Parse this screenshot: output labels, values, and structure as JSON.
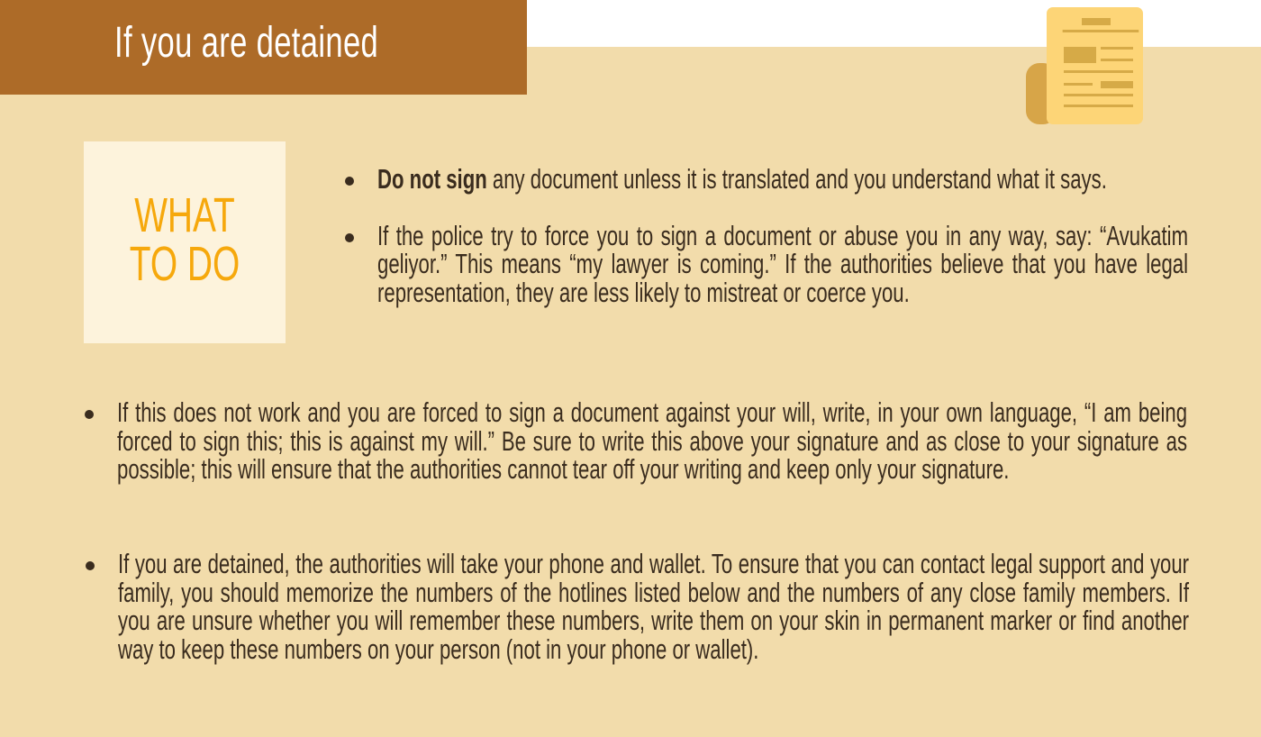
{
  "header": {
    "title": "If you are detained"
  },
  "badge": {
    "line1": "WHAT",
    "line2": "TO DO"
  },
  "bullets": [
    {
      "strong": "Do not sign",
      "text": " any document unless it is translated and you understand what it says."
    },
    {
      "text": "If the police try to force you to sign a document or abuse you in any way, say: “Avukatim geliyor.” This means “my lawyer is coming.” If the authorities believe that you have legal representation, they are less likely to mistreat or coerce you."
    },
    {
      "text": "If this does not work and you are forced to sign a document against your will, write, in your own language, “I am being forced to sign this; this is against my will.” Be sure to write this above your signature and as close to your signature as possible; this will ensure that the authorities cannot tear off your writing and keep only your signature."
    },
    {
      "text": "If you are detained, the authorities will take your phone and wallet. To ensure that you can contact legal support and your family, you should memorize the numbers of the hotlines listed below and the numbers of any close family members. If you are unsure whether you will remember these numbers, write them on your skin in permanent marker or find another way to keep these numbers on your person (not in your phone or wallet)."
    }
  ],
  "colors": {
    "header_bg": "#ad6b28",
    "page_bg": "#f2dcab",
    "badge_bg": "#fdf3dc",
    "badge_text": "#f6a80c",
    "body_text": "#3a2c1e"
  },
  "icons": {
    "header_icon": "newspaper-icon"
  }
}
